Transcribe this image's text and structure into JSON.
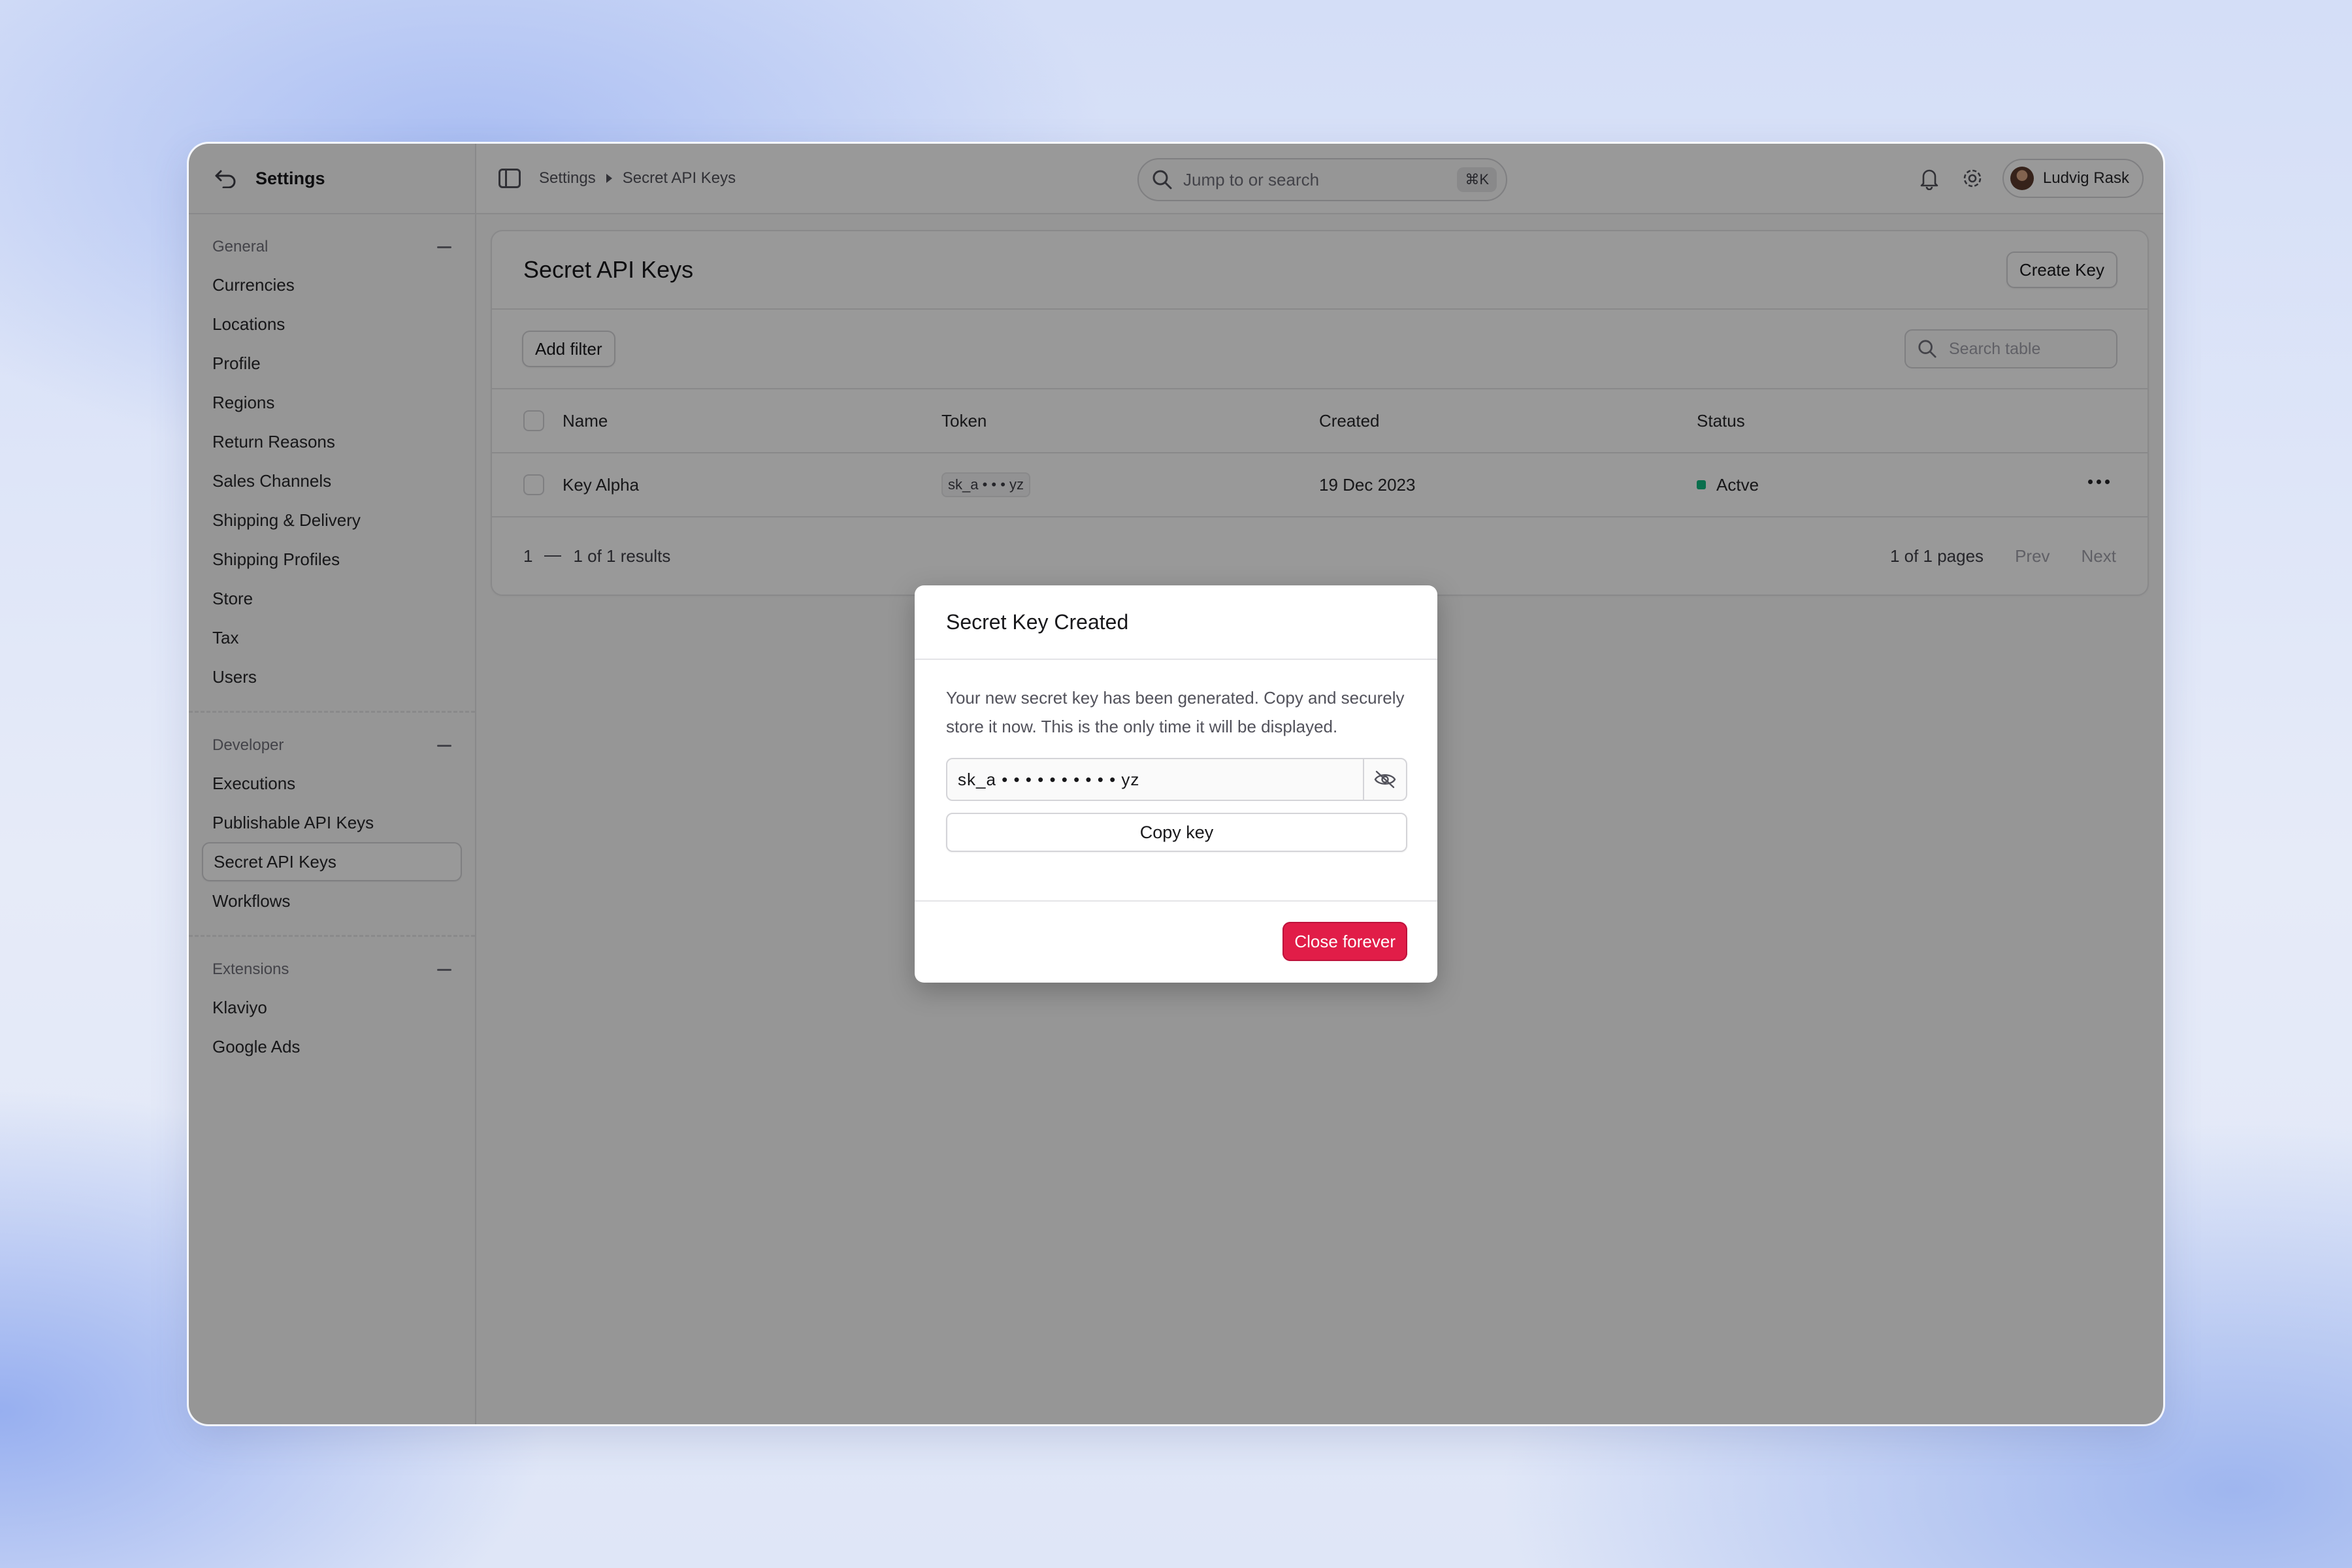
{
  "sidebar": {
    "title": "Settings",
    "sections": [
      {
        "label": "General",
        "items": [
          "Currencies",
          "Locations",
          "Profile",
          "Regions",
          "Return Reasons",
          "Sales Channels",
          "Shipping & Delivery",
          "Shipping Profiles",
          "Store",
          "Tax",
          "Users"
        ]
      },
      {
        "label": "Developer",
        "items": [
          "Executions",
          "Publishable API Keys",
          "Secret API Keys",
          "Workflows"
        ]
      },
      {
        "label": "Extensions",
        "items": [
          "Klaviyo",
          "Google Ads"
        ]
      }
    ],
    "active_item": "Secret API Keys"
  },
  "topbar": {
    "breadcrumb": [
      "Settings",
      "Secret API Keys"
    ],
    "search_placeholder": "Jump to or search",
    "search_shortcut": "⌘K",
    "user_name": "Ludvig Rask",
    "icons": [
      "sidebar-toggle-icon",
      "search-icon",
      "bell-icon",
      "gear-icon"
    ]
  },
  "page": {
    "title": "Secret API Keys",
    "create_label": "Create Key",
    "add_filter_label": "Add filter",
    "search_table_placeholder": "Search table",
    "table": {
      "columns": [
        "Name",
        "Token",
        "Created",
        "Status"
      ],
      "rows": [
        {
          "name": "Key Alpha",
          "token": "sk_a • • • yz",
          "created": "19 Dec 2023",
          "status": "Actve",
          "status_color": "#10b981"
        }
      ]
    },
    "pagination": {
      "range_start": "1",
      "range_text": "1 of 1 results",
      "pages_text": "1 of 1 pages",
      "prev": "Prev",
      "next": "Next"
    }
  },
  "modal": {
    "title": "Secret Key Created",
    "message": "Your new secret key has been generated. Copy and securely store it now. This is the only time it will be displayed.",
    "key_value": "sk_a • • • • • • • • • • yz",
    "copy_label": "Copy key",
    "close_label": "Close forever",
    "close_color": "#e11d48"
  }
}
